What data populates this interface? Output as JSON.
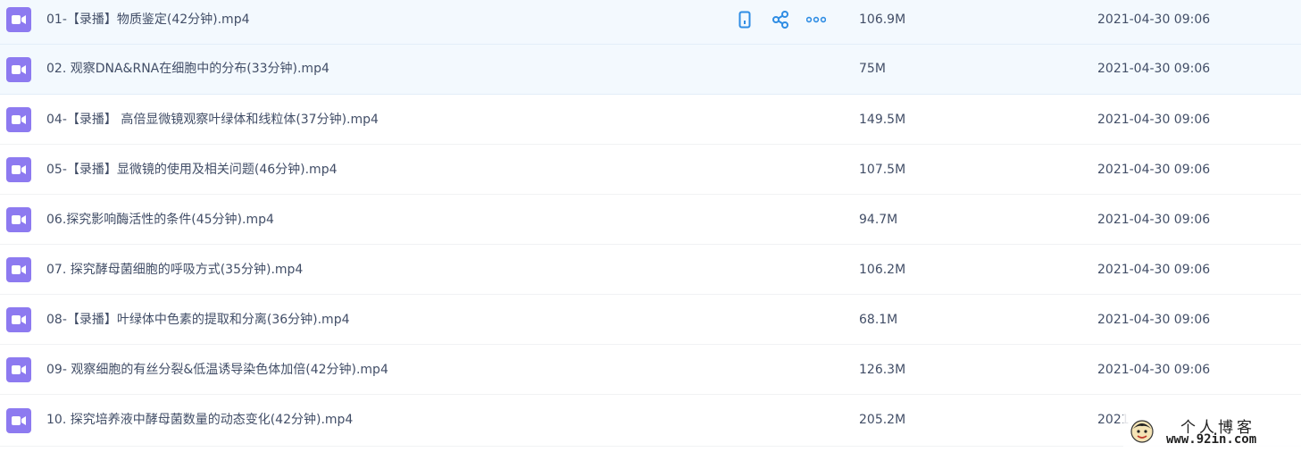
{
  "files": [
    {
      "name": "01-【录播】物质鉴定(42分钟).mp4",
      "size": "106.9M",
      "date": "2021-04-30 09:06"
    },
    {
      "name": "02. 观察DNA&RNA在细胞中的分布(33分钟).mp4",
      "size": "75M",
      "date": "2021-04-30 09:06"
    },
    {
      "name": "04-【录播】 高倍显微镜观察叶绿体和线粒体(37分钟).mp4",
      "size": "149.5M",
      "date": "2021-04-30 09:06"
    },
    {
      "name": "05-【录播】显微镜的使用及相关问题(46分钟).mp4",
      "size": "107.5M",
      "date": "2021-04-30 09:06"
    },
    {
      "name": "06.探究影响酶活性的条件(45分钟).mp4",
      "size": "94.7M",
      "date": "2021-04-30 09:06"
    },
    {
      "name": "07. 探究酵母菌细胞的呼吸方式(35分钟).mp4",
      "size": "106.2M",
      "date": "2021-04-30 09:06"
    },
    {
      "name": "08-【录播】叶绿体中色素的提取和分离(36分钟).mp4",
      "size": "68.1M",
      "date": "2021-04-30 09:06"
    },
    {
      "name": "09- 观察细胞的有丝分裂&低温诱导染色体加倍(42分钟).mp4",
      "size": "126.3M",
      "date": "2021-04-30 09:06"
    },
    {
      "name": "10. 探究培养液中酵母菌数量的动态变化(42分钟).mp4",
      "size": "205.2M",
      "date": "2021"
    }
  ],
  "file_icon": "video-file-icon",
  "row_actions": {
    "phone_icon": "phone-icon",
    "share_icon": "share-icon",
    "more_icon": "more-icon"
  },
  "watermark": {
    "title": "个人博客",
    "url": "www.92in.com"
  },
  "colors": {
    "icon_bg": "#8d7af0",
    "action_blue": "#2f8de4",
    "hover_row": "#f3f9fe",
    "text": "#424e67"
  }
}
